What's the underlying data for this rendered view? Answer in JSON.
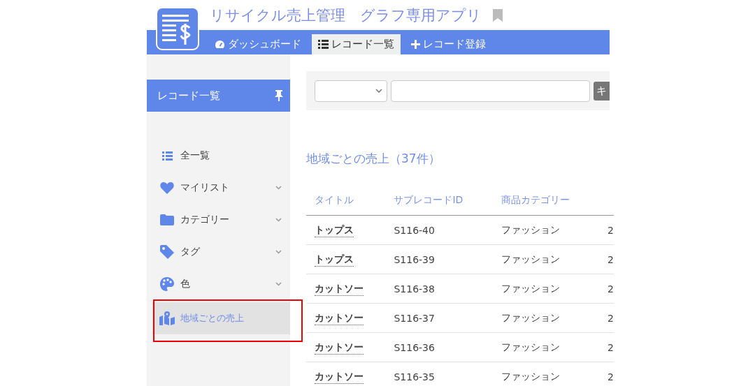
{
  "app": {
    "title": "リサイクル売上管理　グラフ専用アプリ"
  },
  "tabs": [
    {
      "label": "ダッシュボード",
      "selected": false
    },
    {
      "label": "レコード一覧",
      "selected": true
    },
    {
      "label": "レコード登録",
      "selected": false
    }
  ],
  "sidebar": {
    "title": "レコード一覧",
    "items": [
      {
        "label": "全一覧",
        "expandable": false,
        "selected": false,
        "highlighted": false
      },
      {
        "label": "マイリスト",
        "expandable": true,
        "selected": false,
        "highlighted": false
      },
      {
        "label": "カテゴリー",
        "expandable": true,
        "selected": false,
        "highlighted": false
      },
      {
        "label": "タグ",
        "expandable": true,
        "selected": false,
        "highlighted": false
      },
      {
        "label": "色",
        "expandable": true,
        "selected": false,
        "highlighted": false
      },
      {
        "label": "地域ごとの売上",
        "expandable": false,
        "selected": true,
        "highlighted": true
      }
    ]
  },
  "search": {
    "button": "キ"
  },
  "list": {
    "heading": "地域ごとの売上（37件）",
    "columns": [
      "タイトル",
      "サブレコードID",
      "商品カテゴリー"
    ],
    "rows": [
      [
        "トップス",
        "S116-40",
        "ファッション",
        "2"
      ],
      [
        "トップス",
        "S116-39",
        "ファッション",
        "2"
      ],
      [
        "カットソー",
        "S116-38",
        "ファッション",
        "2"
      ],
      [
        "カットソー",
        "S116-37",
        "ファッション",
        "2"
      ],
      [
        "カットソー",
        "S116-36",
        "ファッション",
        "2"
      ],
      [
        "カットソー",
        "S116-35",
        "ファッション",
        "2"
      ]
    ]
  }
}
